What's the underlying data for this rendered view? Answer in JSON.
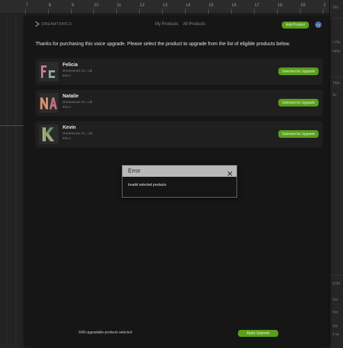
{
  "ruler": {
    "ticks": [
      "7",
      "8",
      "9",
      "10",
      "11",
      "12",
      "13",
      "14",
      "15",
      "16",
      "17",
      "18",
      "19",
      "2"
    ]
  },
  "right_panel": {
    "labels": [
      "SEL",
      "n Na",
      "nicke",
      "TRA",
      "Sc",
      "FOR",
      "Nor",
      "Nor",
      "Sel",
      "6 se"
    ]
  },
  "app": {
    "brand": "DREAMTONICS",
    "nav": {
      "my_products": "My Products",
      "all_products": "All Products"
    },
    "add_product_label": "Add Product"
  },
  "intro_text": "Thanks for purchasing this voice upgrade. Please select the product to upgrade from the list of eligible products below.",
  "products": [
    {
      "name": "Felicia",
      "company": "Dreamtonics Co., Ltd.",
      "eula": "EULA",
      "button": "Selected for Upgrade",
      "initials": "Fc"
    },
    {
      "name": "Natalie",
      "company": "Dreamtonics Co., Ltd.",
      "eula": "EULA",
      "button": "Selected for Upgrade",
      "initials": "NA"
    },
    {
      "name": "Kevin",
      "company": "Dreamtonics Co., Ltd.",
      "eula": "EULA",
      "button": "Selected for Upgrade",
      "initials": "K"
    }
  ],
  "footer": {
    "count_text": "5/99 upgradable products selected",
    "apply_label": "Apply Upgrade"
  },
  "error_dialog": {
    "title": "Error",
    "message": "Invalid selected products"
  },
  "colors": {
    "accent_green": "#5a9e1c",
    "power_blue": "#1d3f86"
  }
}
